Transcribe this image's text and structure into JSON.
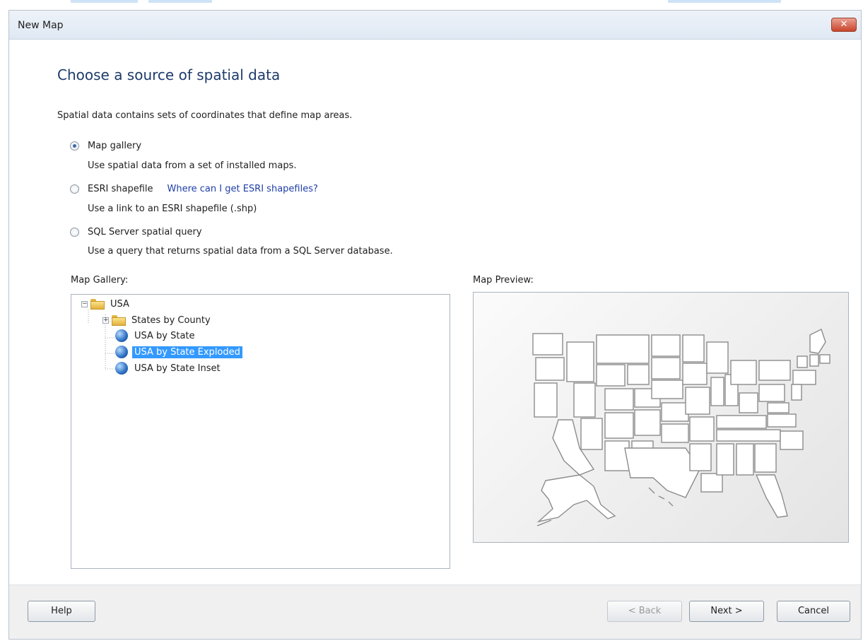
{
  "window": {
    "title": "New Map",
    "close_symbol": "✕"
  },
  "page": {
    "heading": "Choose a source of spatial data",
    "description": "Spatial data contains sets of coordinates that define map areas."
  },
  "options": [
    {
      "label": "Map gallery",
      "description": "Use spatial data from a set of installed maps.",
      "checked": true
    },
    {
      "label": "ESRI shapefile",
      "link": "Where can I get ESRI shapefiles?",
      "description": "Use a link to an ESRI shapefile (.shp)",
      "checked": false
    },
    {
      "label": "SQL Server spatial query",
      "description": "Use a query that returns spatial data from a SQL Server database.",
      "checked": false
    }
  ],
  "gallery": {
    "label": "Map Gallery:",
    "root": {
      "label": "USA",
      "expander": "−"
    },
    "items": [
      {
        "label": "States by County",
        "icon": "folder-icon",
        "expander": "+"
      },
      {
        "label": "USA by State",
        "icon": "globe-icon"
      },
      {
        "label": "USA by State Exploded",
        "icon": "globe-icon",
        "selected": true
      },
      {
        "label": "USA by State Inset",
        "icon": "globe-icon"
      }
    ]
  },
  "preview": {
    "label": "Map Preview:"
  },
  "footer": {
    "help": "Help",
    "back": "< Back",
    "next": "Next >",
    "cancel": "Cancel"
  },
  "colors": {
    "heading": "#1e3b6a",
    "link": "#1f3fa8",
    "selection": "#3399ff"
  }
}
